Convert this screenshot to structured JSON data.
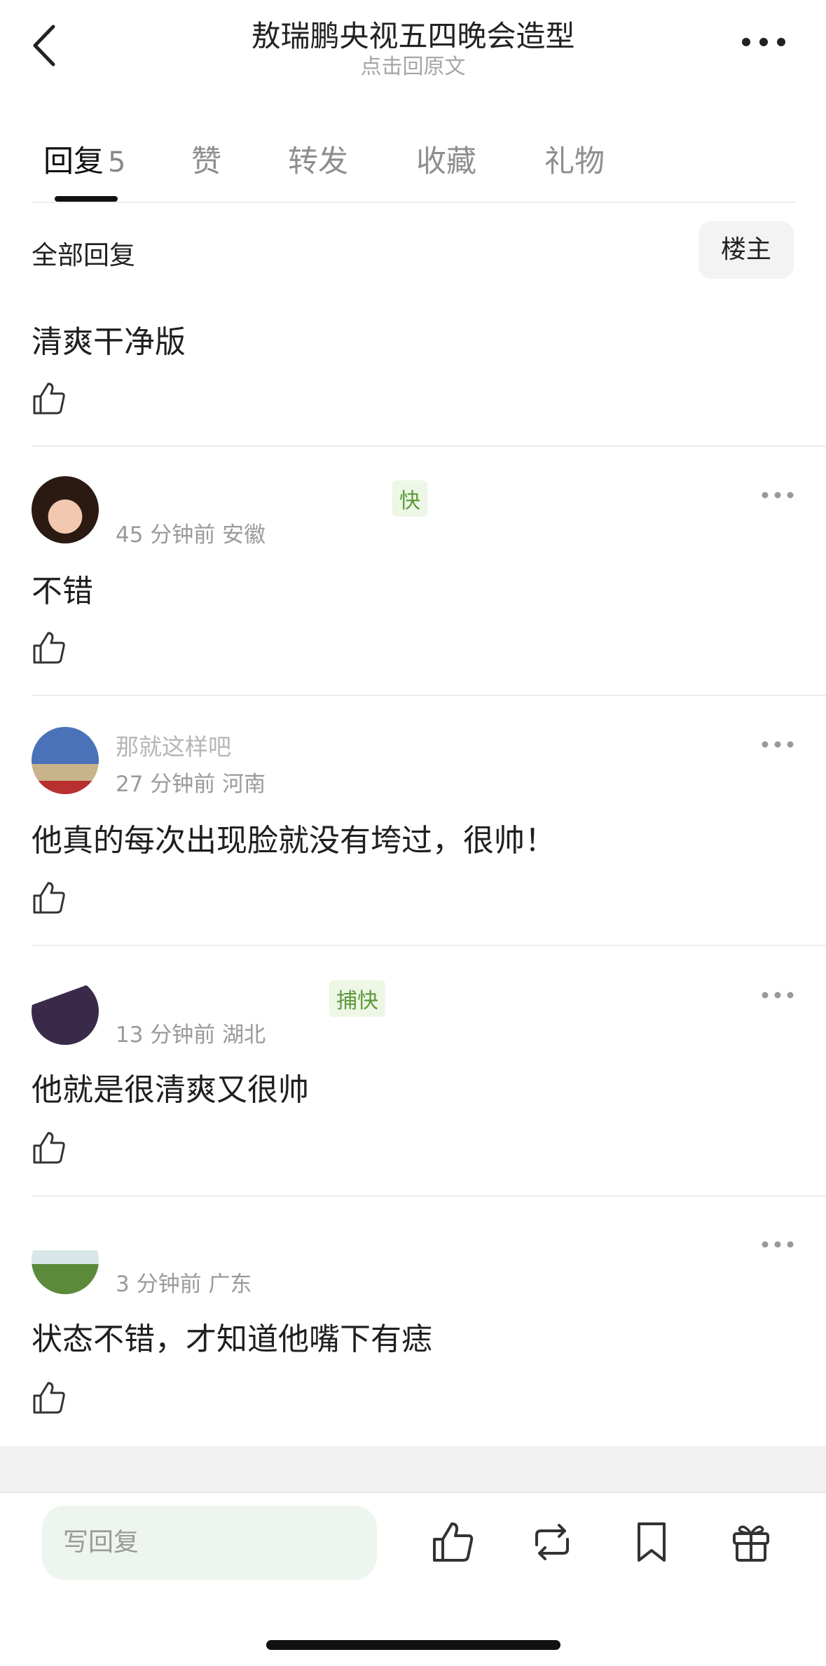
{
  "header": {
    "title": "敖瑞鹏央视五四晚会造型",
    "subtitle": "点击回原文"
  },
  "tabs": [
    {
      "label": "回复",
      "count": "5"
    },
    {
      "label": "赞"
    },
    {
      "label": "转发"
    },
    {
      "label": "收藏"
    },
    {
      "label": "礼物"
    }
  ],
  "filter": {
    "all_replies": "全部回复",
    "op_only": "楼主"
  },
  "top_reply": {
    "text": "清爽干净版"
  },
  "comments": [
    {
      "username": "",
      "tag": "快",
      "time": "45 分钟前",
      "location": "安徽",
      "text": "不错"
    },
    {
      "username": "那就这样吧",
      "tag": "",
      "time": "27 分钟前",
      "location": "河南",
      "text": "他真的每次出现脸就没有垮过，很帅！"
    },
    {
      "username": "",
      "tag": "捕快",
      "time": "13 分钟前",
      "location": "湖北",
      "text": "他就是很清爽又很帅"
    },
    {
      "username": "",
      "tag": "",
      "time": "3 分钟前",
      "location": "广东",
      "text": "状态不错，才知道他嘴下有痣"
    }
  ],
  "bottom_bar": {
    "reply_placeholder": "写回复"
  },
  "icons": {
    "back": "chevron-left-icon",
    "more": "more-horizontal-icon",
    "like": "thumb-up-icon",
    "repost": "repost-icon",
    "bookmark": "bookmark-icon",
    "gift": "gift-icon"
  },
  "colors": {
    "tag_green": "#5a9a3a",
    "reply_input_bg": "#eef5ee",
    "text_primary": "#1f1f1f",
    "text_secondary": "#9a9a9a"
  }
}
